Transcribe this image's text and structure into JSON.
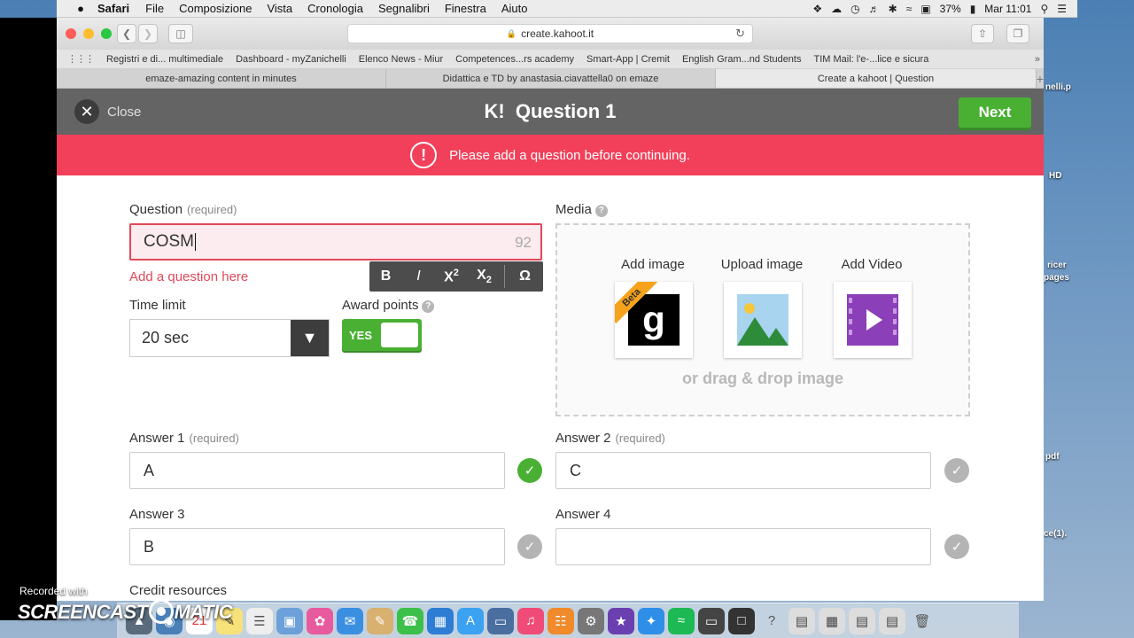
{
  "menubar": {
    "app_name": "Safari",
    "items": [
      "File",
      "Composizione",
      "Vista",
      "Cronologia",
      "Segnalibri",
      "Finestra",
      "Aiuto"
    ],
    "battery": "37%",
    "clock": "Mar 11:01"
  },
  "desktop": {
    "labels": [
      "nelli.p",
      "HD",
      "ricer",
      "pages",
      "pdf",
      "ce(1)."
    ]
  },
  "browser": {
    "url": "create.kahoot.it",
    "bookmarks": [
      "Registri e di... multimediale",
      "Dashboard - myZanichelli",
      "Elenco News - Miur",
      "Competences...rs academy",
      "Smart-App | Cremit",
      "English Gram...nd Students",
      "TIM Mail: l'e-...lice e sicura"
    ],
    "tabs": [
      "emaze-amazing content in minutes",
      "Didattica e TD by anastasia.ciavattella0 on emaze",
      "Create a kahoot | Question"
    ]
  },
  "header": {
    "close_label": "Close",
    "logo": "K!",
    "title": "Question 1",
    "next_label": "Next"
  },
  "alert": {
    "icon_glyph": "!",
    "message": "Please add a question before continuing."
  },
  "form": {
    "question_label": "Question",
    "required_text": "(required)",
    "question_value": "COSM",
    "char_count": "92",
    "question_error": "Add a question here",
    "toolbar": {
      "bold": "B",
      "italic": "I",
      "superscript_base": "X",
      "superscript_exp": "2",
      "subscript_base": "X",
      "subscript_idx": "2",
      "special": "Ω"
    },
    "time_limit_label": "Time limit",
    "time_limit_value": "20 sec",
    "award_points_label": "Award points",
    "award_points_value": "YES",
    "media_label": "Media",
    "media": {
      "add_image": "Add image",
      "upload_image": "Upload image",
      "add_video": "Add Video",
      "beta": "Beta",
      "getty_glyph": "g",
      "drag_text": "or drag & drop image"
    },
    "answers": [
      {
        "label": "Answer 1",
        "required": "(required)",
        "value": "A",
        "correct": true
      },
      {
        "label": "Answer 2",
        "required": "(required)",
        "value": "C",
        "correct": false
      },
      {
        "label": "Answer 3",
        "required": "",
        "value": "B",
        "correct": false
      },
      {
        "label": "Answer 4",
        "required": "",
        "value": "",
        "correct": false
      }
    ],
    "credit_label": "Credit resources"
  },
  "watermark": {
    "line1": "Recorded with",
    "line2_a": "SCREENCAST",
    "line2_b": "MATIC"
  },
  "colors": {
    "kahoot_green": "#4ab034",
    "alert_red": "#f2405a",
    "header_gray": "#646464"
  }
}
